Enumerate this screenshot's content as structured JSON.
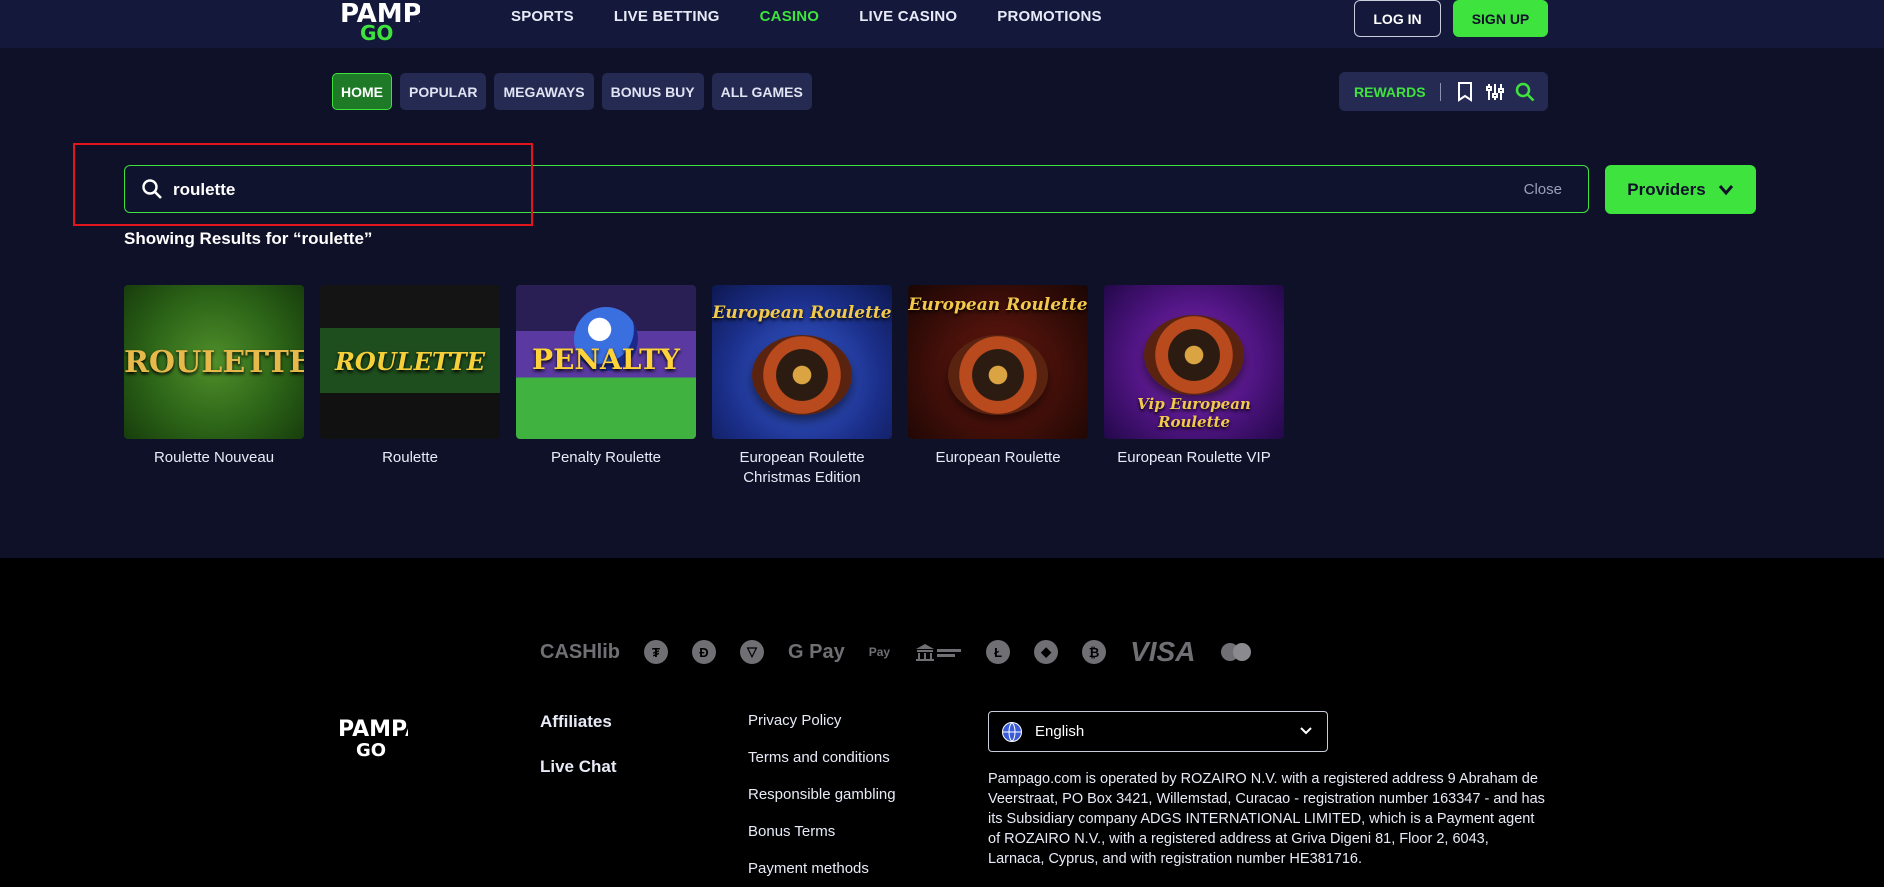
{
  "header": {
    "logo_text": "PAMPA GO",
    "nav": [
      {
        "label": "SPORTS",
        "active": false
      },
      {
        "label": "LIVE BETTING",
        "active": false
      },
      {
        "label": "CASINO",
        "active": true
      },
      {
        "label": "LIVE CASINO",
        "active": false
      },
      {
        "label": "PROMOTIONS",
        "active": false
      }
    ],
    "login_label": "LOG IN",
    "signup_label": "SIGN UP"
  },
  "tabs": [
    {
      "label": "HOME",
      "active": true
    },
    {
      "label": "POPULAR",
      "active": false
    },
    {
      "label": "MEGAWAYS",
      "active": false
    },
    {
      "label": "BONUS BUY",
      "active": false
    },
    {
      "label": "ALL GAMES",
      "active": false
    }
  ],
  "toolbar": {
    "rewards_label": "REWARDS",
    "icons": [
      "bookmark-icon",
      "filter-sliders-icon",
      "search-icon"
    ]
  },
  "search": {
    "value": "roulette",
    "close_label": "Close",
    "providers_label": "Providers",
    "results_title": "Showing Results for “roulette”"
  },
  "games": [
    {
      "name": "Roulette Nouveau",
      "art_text": "ROULETTE"
    },
    {
      "name": "Roulette",
      "art_text": "ROULETTE"
    },
    {
      "name": "Penalty Roulette",
      "art_text": "PENALTY"
    },
    {
      "name": "European Roulette Christmas Edition",
      "art_text": "European Roulette"
    },
    {
      "name": "European Roulette",
      "art_text": "European Roulette"
    },
    {
      "name": "European Roulette VIP",
      "art_text": "Vip European Roulette"
    }
  ],
  "footer": {
    "payments": [
      "CASHlib",
      "G Pay",
      "Pay",
      "VISA"
    ],
    "links_main": [
      "Affiliates",
      "Live Chat"
    ],
    "links_secondary": [
      "Privacy Policy",
      "Terms and conditions",
      "Responsible gambling",
      "Bonus Terms",
      "Payment methods"
    ],
    "language": "English",
    "legal_text": "Pampago.com is operated by ROZAIRO N.V. with a registered address 9 Abraham de Veerstraat, PO Box 3421, Willemstad, Curacao - registration number 163347 - and has its Subsidiary company ADGS INTERNATIONAL LIMITED, which is a Payment agent of ROZAIRO N.V., with a registered address at Griva Digeni 81, Floor 2, 6043, Larnaca, Cyprus, and with registration number HE381716."
  },
  "colors": {
    "accent": "#3ee33e",
    "background": "#0f1128",
    "panel": "#252a52",
    "highlight": "#e3141b"
  }
}
